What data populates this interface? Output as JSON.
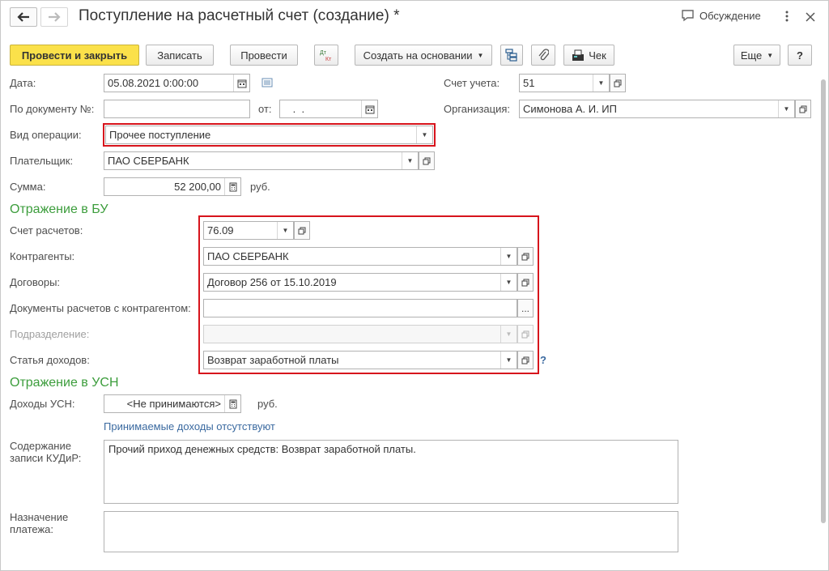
{
  "window": {
    "title": "Поступление на расчетный счет (создание) *",
    "discussion_label": "Обсуждение"
  },
  "toolbar": {
    "post_close": "Провести и закрыть",
    "save": "Записать",
    "post": "Провести",
    "dt_kt": "Дт Кт",
    "create_based": "Создать на основании",
    "receipt": "Чек",
    "more": "Еще",
    "help": "?"
  },
  "form": {
    "date_label": "Дата:",
    "date_value": "05.08.2021  0:00:00",
    "account_label": "Счет учета:",
    "account_value": "51",
    "doc_num_label": "По документу №:",
    "doc_num_value": "",
    "from_label": "от:",
    "from_value": " .  .",
    "org_label": "Организация:",
    "org_value": "Симонова А. И. ИП",
    "op_type_label": "Вид операции:",
    "op_type_value": "Прочее поступление",
    "payer_label": "Плательщик:",
    "payer_value": "ПАО СБЕРБАНК",
    "sum_label": "Сумма:",
    "sum_value": "52 200,00",
    "sum_currency": "руб."
  },
  "bu": {
    "section_title": "Отражение в БУ",
    "settlement_account_label": "Счет расчетов:",
    "settlement_account_value": "76.09",
    "counterparties_label": "Контрагенты:",
    "counterparties_value": "ПАО СБЕРБАНК",
    "contracts_label": "Договоры:",
    "contracts_value": "Договор 256 от 15.10.2019",
    "settlement_docs_label": "Документы расчетов с контрагентом:",
    "settlement_docs_value": "",
    "settlement_docs_btn": "...",
    "division_label": "Подразделение:",
    "division_value": "",
    "income_item_label": "Статья доходов:",
    "income_item_value": "Возврат заработной платы",
    "help_mark": "?"
  },
  "usn": {
    "section_title": "Отражение в УСН",
    "income_label": "Доходы УСН:",
    "income_value": "<Не принимаются>",
    "income_currency": "руб.",
    "no_income_link": "Принимаемые доходы отсутствуют",
    "kudir_label_1": "Содержание",
    "kudir_label_2": "записи КУДиР:",
    "kudir_value": "Прочий приход денежных средств: Возврат заработной платы.",
    "purpose_label_1": "Назначение",
    "purpose_label_2": "платежа:",
    "purpose_value": ""
  },
  "colors": {
    "primary_button": "#fbe14a",
    "section_green": "#3c9d3c",
    "highlight_red": "#d7141c",
    "link_blue": "#3b6aa0"
  },
  "icons": {
    "back": "arrow-left-icon",
    "forward": "arrow-right-icon",
    "discussion": "chat-bubble-icon",
    "menu": "kebab-menu-icon",
    "close": "close-icon",
    "calendar": "calendar-icon",
    "calculator": "calculator-icon",
    "open": "open-window-icon",
    "dropdown": "triangle-down-icon"
  }
}
